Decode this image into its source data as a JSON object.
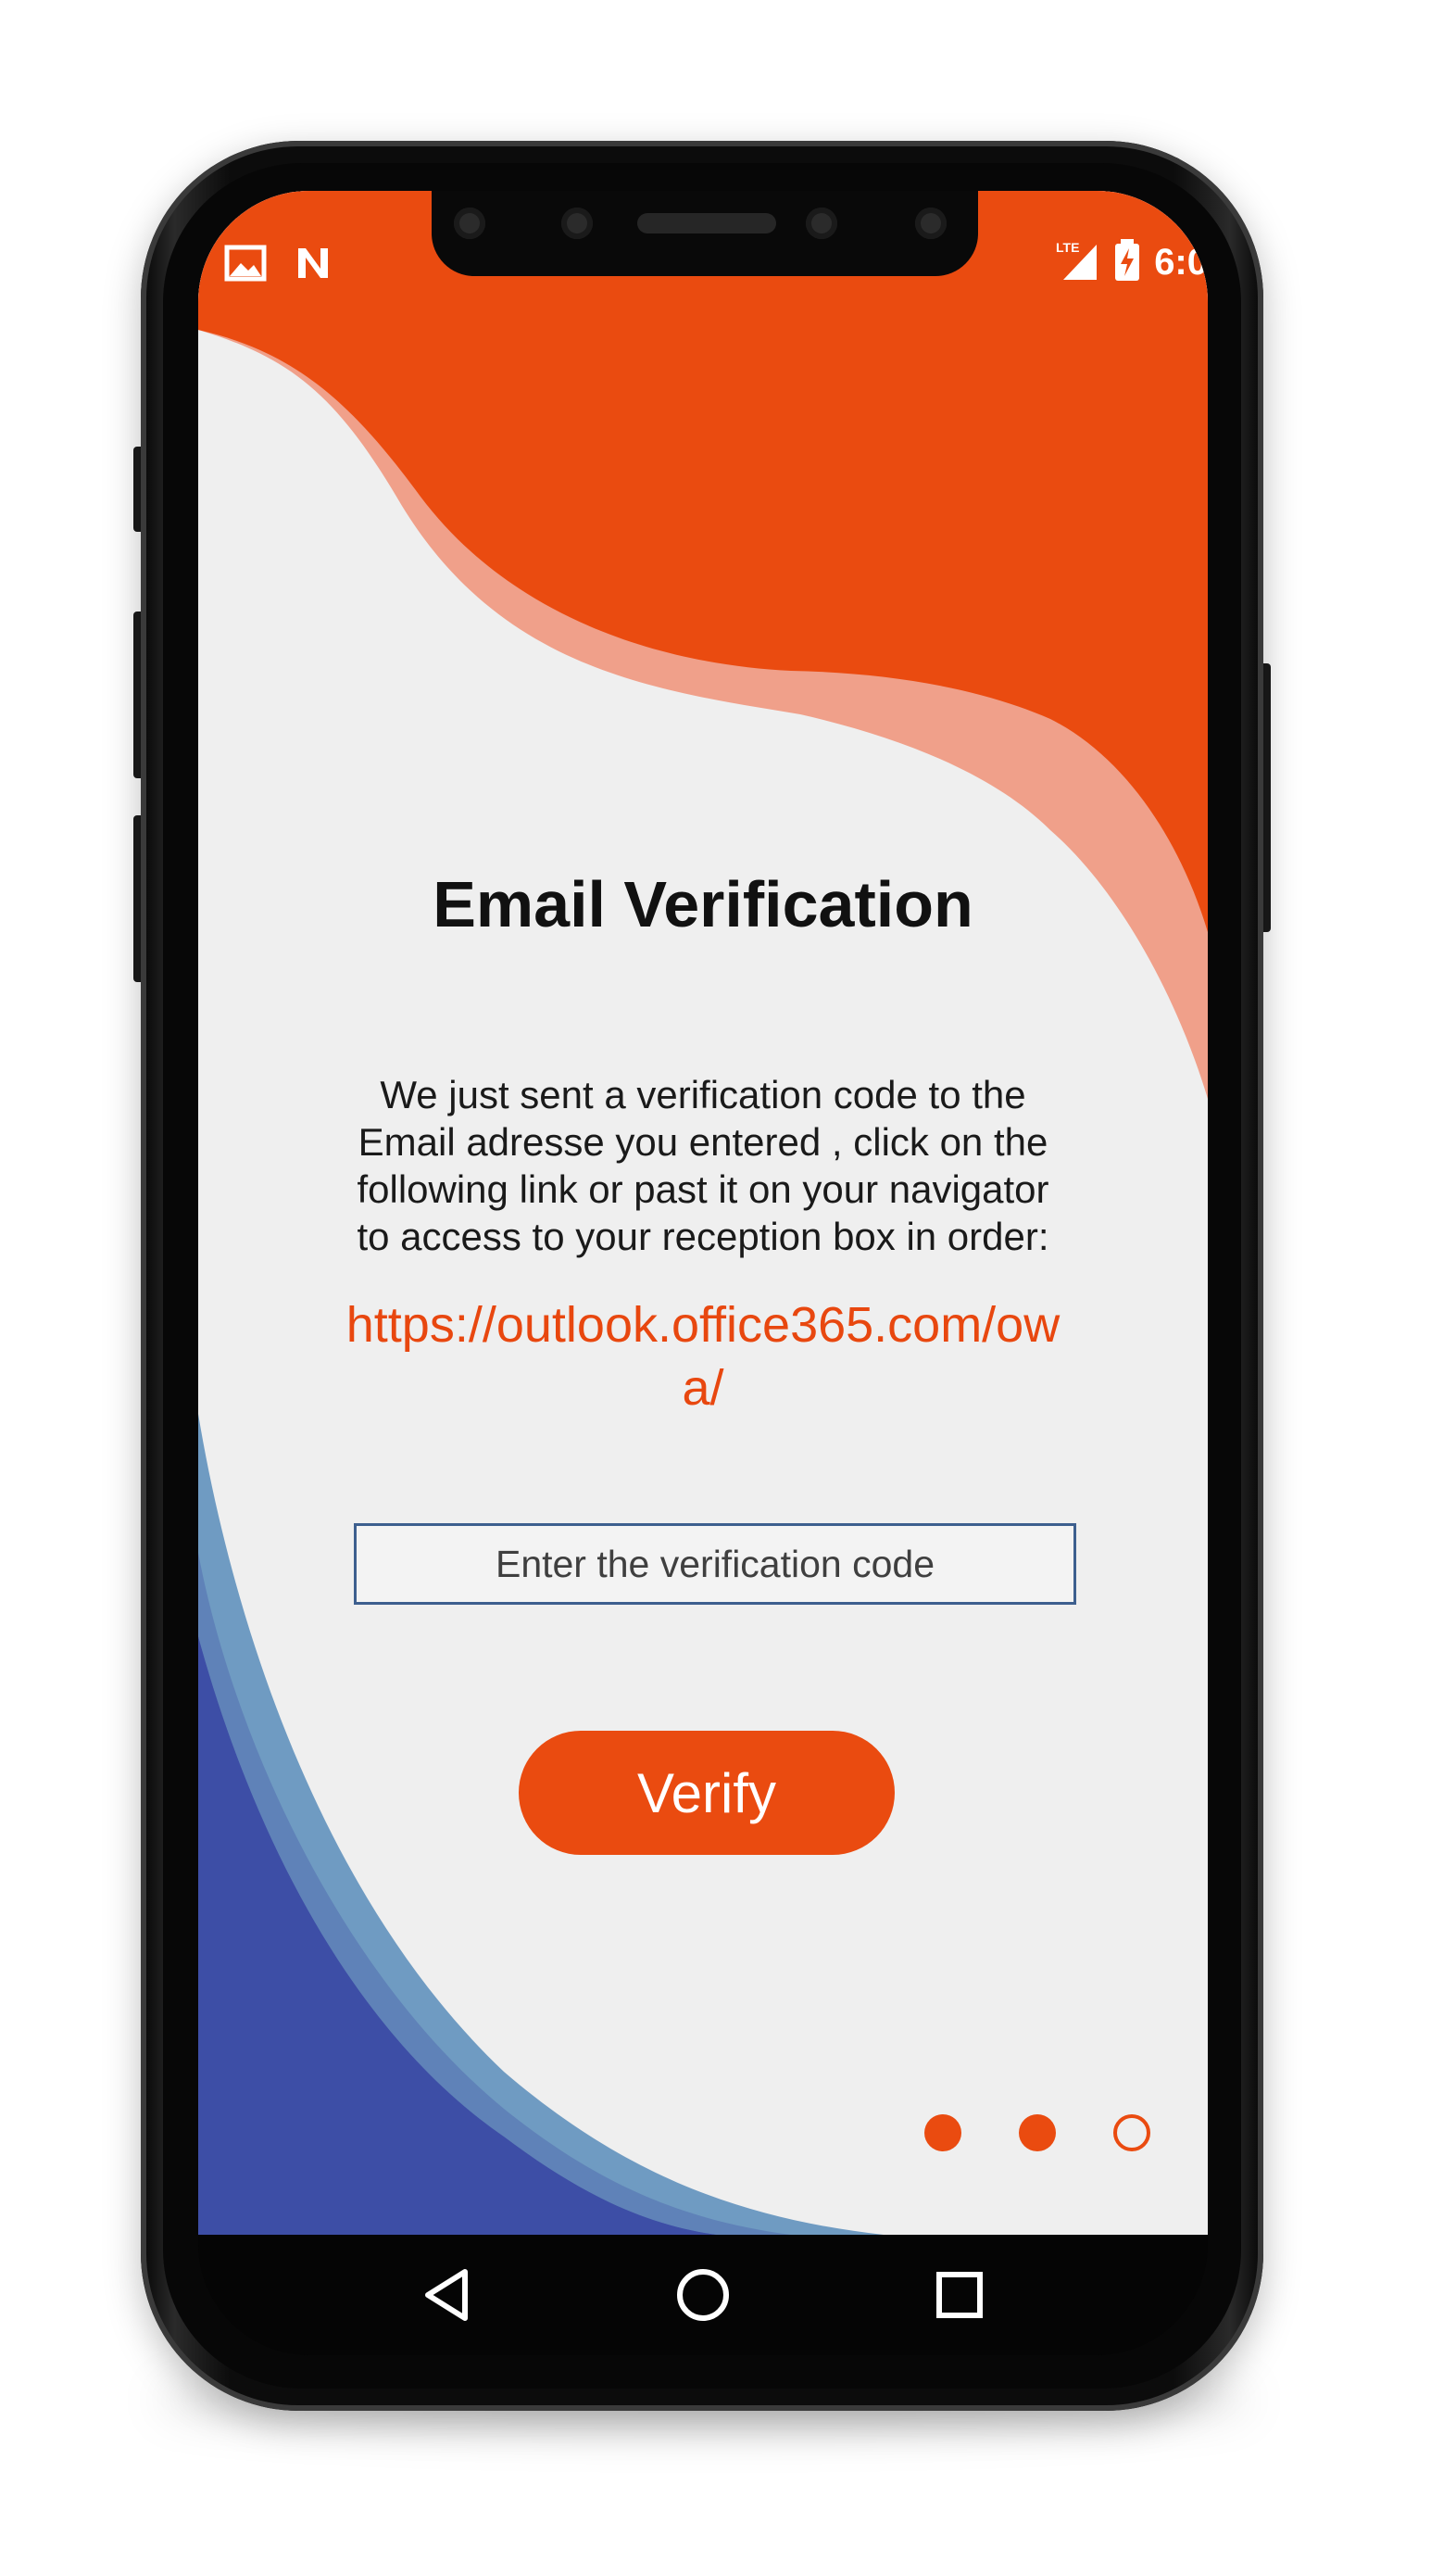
{
  "status_bar": {
    "time": "6:0",
    "network_label": "LTE",
    "left_icons": [
      "image-icon",
      "n-icon"
    ],
    "right_icons": [
      "signal-icon",
      "battery-charging-icon"
    ]
  },
  "screen": {
    "title": "Email Verification",
    "message": "We just sent a verification code to the Email adresse you entered , click on the following link  or past it on your navigator to access to your reception box in order:",
    "link": "https://outlook.office365.com/owa/",
    "code_input": {
      "placeholder": "Enter the verification code",
      "value": ""
    },
    "verify_button": "Verify",
    "pagination": {
      "total": 3,
      "current": 2
    }
  },
  "navigation": {
    "back": "back-icon",
    "home": "home-icon",
    "recents": "recents-icon"
  },
  "colors": {
    "accent": "#ea4b10",
    "accent_light": "#f0a08a",
    "blue_dark": "#3d4ea6",
    "blue_light": "#6f9bc2",
    "background": "#efefef"
  }
}
